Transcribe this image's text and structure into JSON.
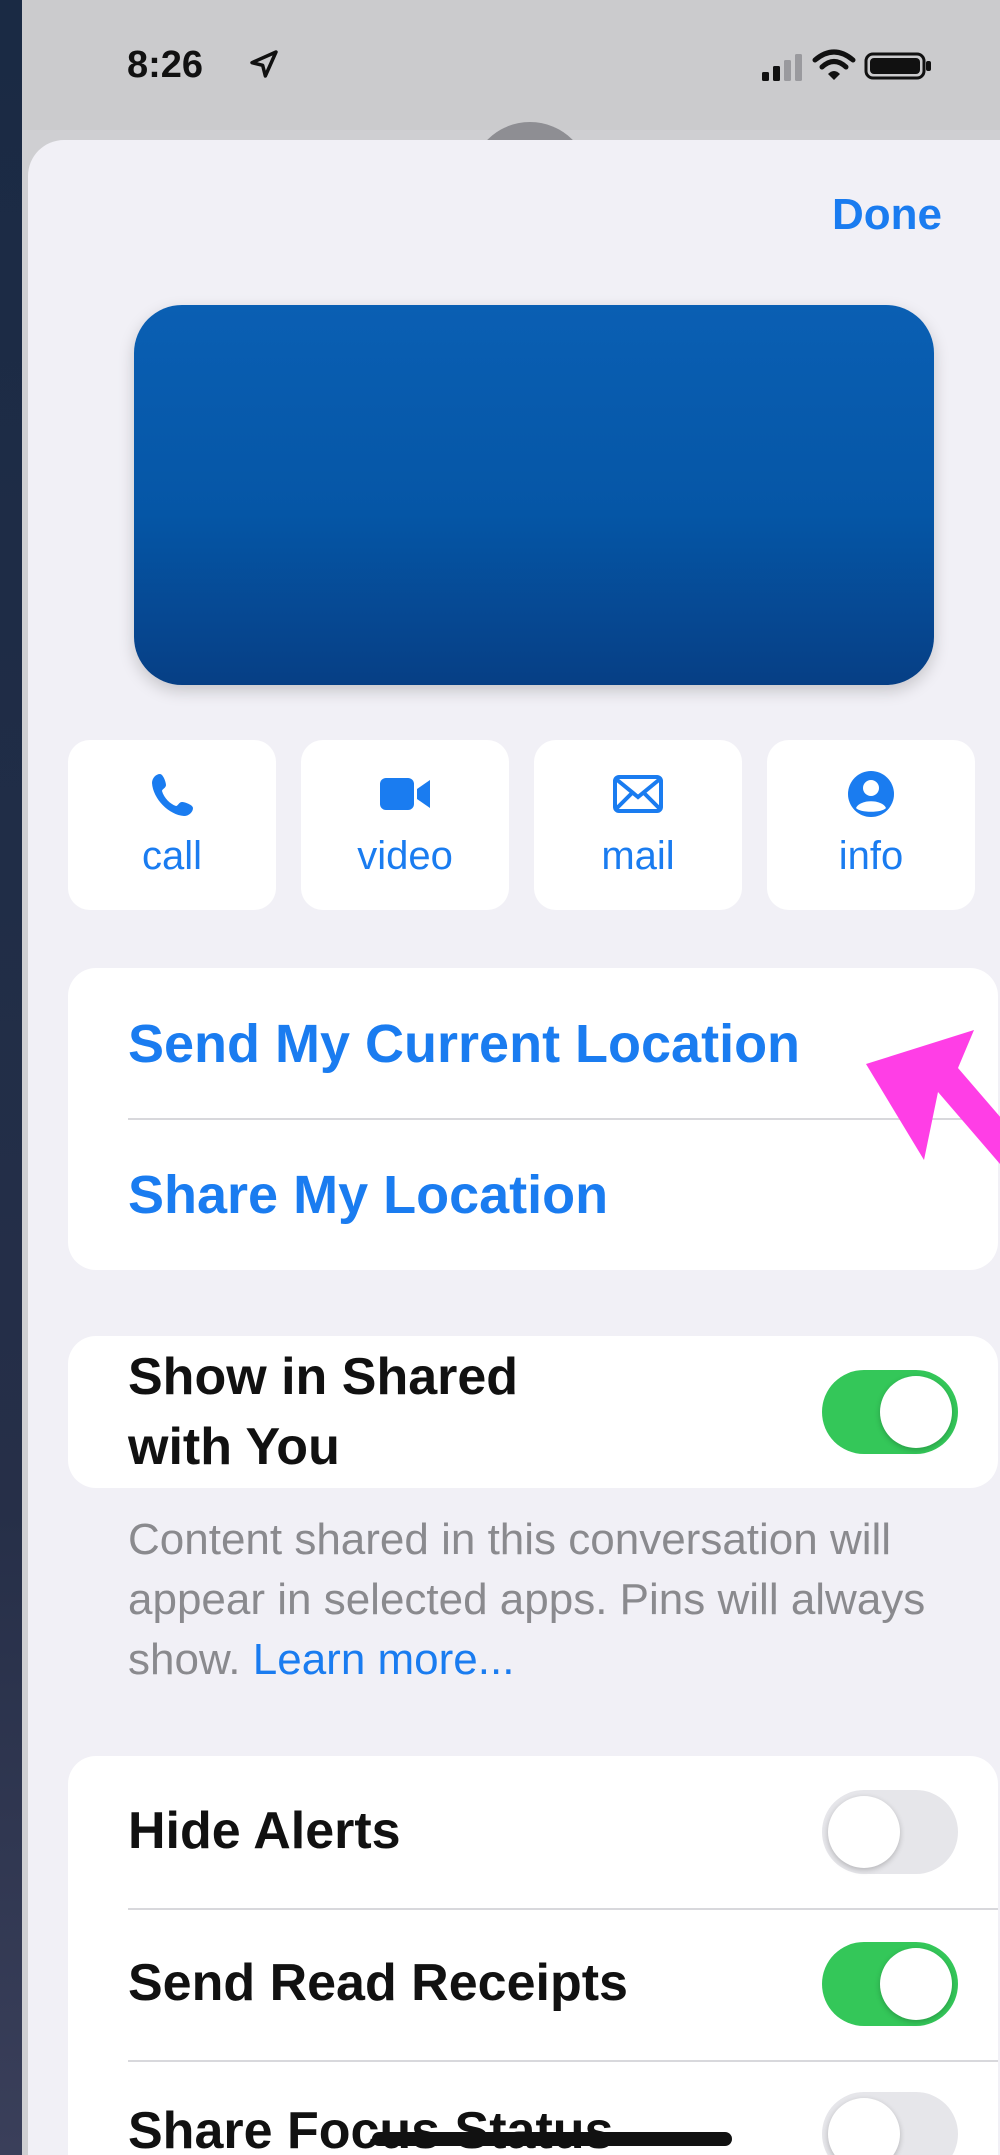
{
  "status_bar": {
    "time": "8:26",
    "icons": [
      "location-arrow-icon",
      "cellular-signal-icon",
      "wifi-icon",
      "battery-icon"
    ]
  },
  "header": {
    "done_label": "Done"
  },
  "actions": [
    {
      "label": "call",
      "icon": "phone-icon"
    },
    {
      "label": "video",
      "icon": "video-camera-icon"
    },
    {
      "label": "mail",
      "icon": "envelope-icon"
    },
    {
      "label": "info",
      "icon": "person-circle-icon"
    }
  ],
  "location": {
    "send_current": "Send My Current Location",
    "share": "Share My Location"
  },
  "shared_with_you": {
    "label_line1": "Show in Shared",
    "label_line2": "with You",
    "enabled": true,
    "footnote": "Content shared in this conversation will appear in selected apps. Pins will always show.",
    "learn_more": "Learn more..."
  },
  "settings": [
    {
      "label": "Hide Alerts",
      "enabled": false
    },
    {
      "label": "Send Read Receipts",
      "enabled": true
    },
    {
      "label": "Share Focus Status",
      "enabled": false
    }
  ],
  "colors": {
    "accent": "#1a7cf0",
    "toggle_on": "#34c759",
    "annotation_arrow": "#ff3ee6"
  }
}
